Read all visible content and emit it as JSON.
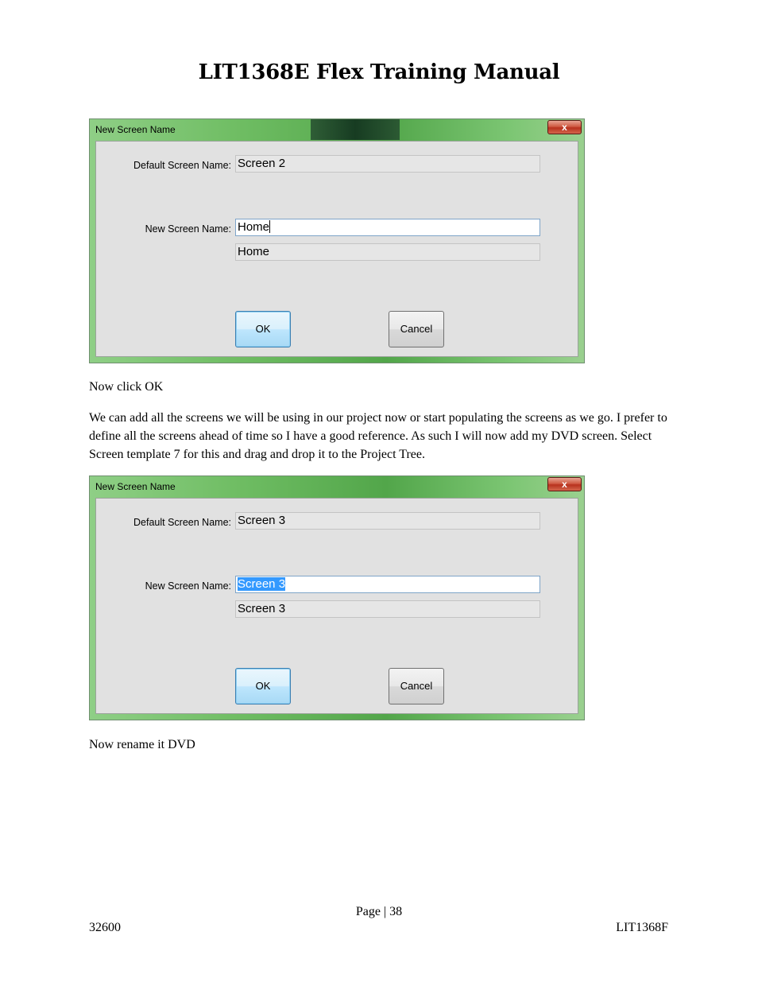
{
  "header": {
    "title": "LIT1368E Flex Training Manual"
  },
  "dialogs": [
    {
      "title": "New Screen Name",
      "close_label": "x",
      "default_label": "Default Screen Name:",
      "default_value": "Screen 2",
      "new_label": "New Screen Name:",
      "new_value": "Home",
      "preview_value": "Home",
      "ok_label": "OK",
      "cancel_label": "Cancel"
    },
    {
      "title": "New Screen Name",
      "close_label": "x",
      "default_label": "Default Screen Name:",
      "default_value": "Screen 3",
      "new_label": "New Screen Name:",
      "new_value": "Screen 3",
      "preview_value": "Screen 3",
      "ok_label": "OK",
      "cancel_label": "Cancel"
    }
  ],
  "body": {
    "p1": "Now click OK",
    "p2": "We can add all the screens we will be using in our project now or start populating the screens as we go. I prefer to define all the screens ahead of time so I have a good reference.  As such I will now add my DVD screen. Select Screen template 7 for this and drag and drop it to the Project Tree.",
    "p3": "Now rename it DVD"
  },
  "footer": {
    "page": "Page | 38",
    "left": "32600",
    "right": "LIT1368F"
  }
}
